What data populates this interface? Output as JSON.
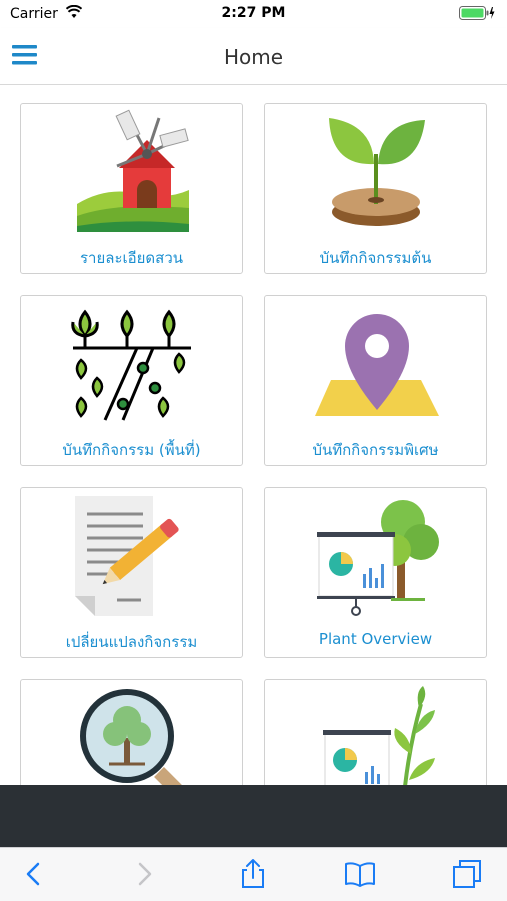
{
  "status_bar": {
    "carrier": "Carrier",
    "time": "2:27 PM"
  },
  "nav": {
    "title": "Home",
    "menu_icon": "hamburger-menu-icon"
  },
  "tiles": [
    {
      "label": "รายละเอียดสวน",
      "icon": "windmill-farm-icon"
    },
    {
      "label": "บันทึกกิจกรรมต้น",
      "icon": "sprout-icon"
    },
    {
      "label": "บันทึกกิจกรรม (พื้นที่)",
      "icon": "crop-field-icon"
    },
    {
      "label": "บันทึกกิจกรรมพิเศษ",
      "icon": "map-pin-icon"
    },
    {
      "label": "เปลี่ยนแปลงกิจกรรม",
      "icon": "document-pencil-icon"
    },
    {
      "label": "Plant Overview",
      "icon": "tree-presentation-icon"
    },
    {
      "label": "",
      "icon": "magnifier-tree-icon"
    },
    {
      "label": "",
      "icon": "plant-chart-icon"
    }
  ],
  "toolbar": [
    "back-icon",
    "forward-icon",
    "share-icon",
    "bookmarks-icon",
    "tabs-icon"
  ],
  "colors": {
    "accent": "#1c8fd0",
    "dark_bar": "#2b3035",
    "battery": "#4cd964"
  }
}
